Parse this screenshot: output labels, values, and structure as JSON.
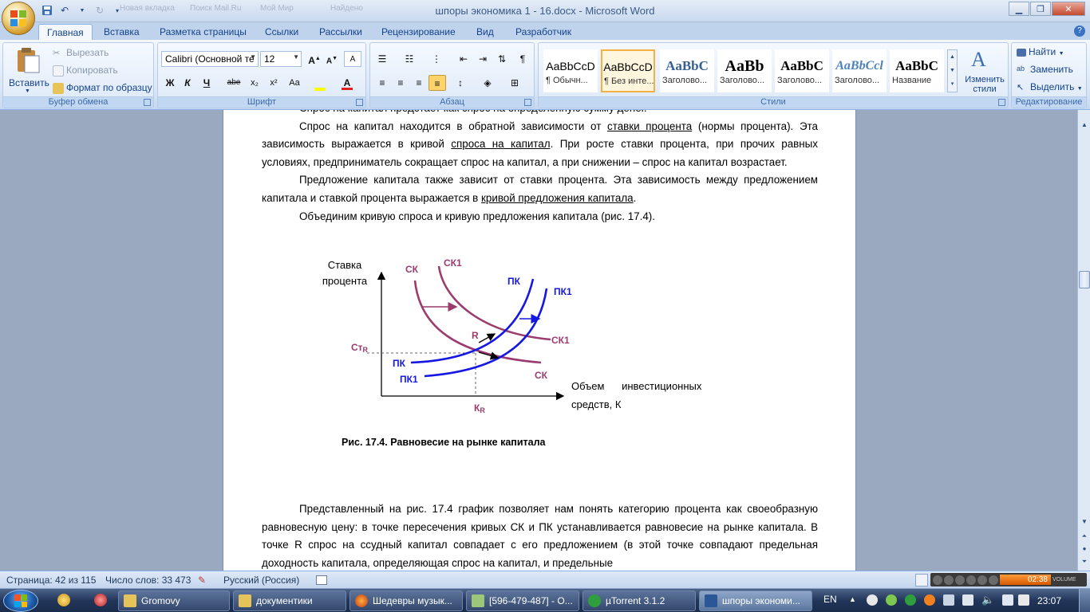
{
  "window": {
    "title": "шпоры экономика 1 - 16.docx - Microsoft Word",
    "background_tabs": [
      "Новая вкладка",
      "Поиск Mail.Ru",
      "Мой Мир",
      "Найдено",
      "Главная"
    ]
  },
  "colors": {
    "demand_curve": "#9b3b6e",
    "supply_curve": "#1418e0",
    "accent": "#f3b044",
    "ribbon_bg": "#dbe7f6"
  },
  "ribbon_tabs": [
    {
      "label": "Главная",
      "active": true
    },
    {
      "label": "Вставка"
    },
    {
      "label": "Разметка страницы"
    },
    {
      "label": "Ссылки"
    },
    {
      "label": "Рассылки"
    },
    {
      "label": "Рецензирование"
    },
    {
      "label": "Вид"
    },
    {
      "label": "Разработчик"
    }
  ],
  "clipboard": {
    "paste": "Вставить",
    "cut": "Вырезать",
    "copy": "Копировать",
    "format_painter": "Формат по образцу",
    "label": "Буфер обмена"
  },
  "font": {
    "family": "Calibri (Основной те",
    "size": "12",
    "label": "Шрифт",
    "buttons": [
      "Ж",
      "К",
      "Ч",
      "abe",
      "x₂",
      "x²",
      "Aa"
    ]
  },
  "paragraph": {
    "label": "Абзац"
  },
  "styles": {
    "label": "Стили",
    "items": [
      {
        "sample": "AaBbCcD",
        "name": "¶ Обычн..."
      },
      {
        "sample": "AaBbCcD",
        "name": "¶ Без инте...",
        "selected": true
      },
      {
        "sample": "AaBbC",
        "name": "Заголово..."
      },
      {
        "sample": "AaBb",
        "name": "Заголово..."
      },
      {
        "sample": "AaBbC",
        "name": "Заголово..."
      },
      {
        "sample": "AaBbCcl",
        "name": "Заголово..."
      },
      {
        "sample": "AaBbC",
        "name": "Название"
      }
    ],
    "change": "Изменить стили"
  },
  "editing": {
    "label": "Редактирование",
    "find": "Найти",
    "replace": "Заменить",
    "select": "Выделить"
  },
  "document": {
    "top_line": "Спрос на капитал предстает как спрос на определенную сумму денег.",
    "p1_a": "Спрос на капитал находится в обратной зависимости от ",
    "p1_link1": "ставки процента",
    "p1_b": " (нормы процента). Эта зависимость выражается в кривой ",
    "p1_link2": "спроса на капитал",
    "p1_c": ". При росте ставки процента, при прочих равных условиях, предприниматель сокращает спрос на капитал, а при снижении – спрос на капитал возрастает.",
    "p2_a": "Предложение капитала также зависит от ставки процента. Эта зависимость между предложением капитала и ставкой процента выражается в ",
    "p2_link": "кривой предложения капитала",
    "p2_b": ".",
    "p3": "Объединим кривую спроса и кривую предложения капитала (рис. 17.4).",
    "caption": "Рис. 17.4. Равновесие на рынке капитала",
    "p4": "Представленный на рис. 17.4 график позволяет нам понять категорию процента как своеобразную равновесную цену: в точке пересечения кривых СК и ПК устанавливается равновесие на рынке капитала. В точке R спрос на ссудный капитал совпадает с его предложением (в этой точке совпадают предельная доходность капитала, определяющая спрос на капитал,  и предельные"
  },
  "chart_data": {
    "type": "line",
    "title": "",
    "ylabel_line1": "Ставка",
    "ylabel_line2": "процента",
    "xlabel_line1": "Объем      инвестиционных",
    "xlabel_line2": "средств, К",
    "equilibrium_y_label": "Ст",
    "equilibrium_y_sub": "R",
    "equilibrium_x_label": "К",
    "equilibrium_x_sub": "R",
    "point_label": "R",
    "series": [
      {
        "name": "СК",
        "kind": "demand",
        "label_top": "СК",
        "label_bottom": "СК"
      },
      {
        "name": "СК1",
        "kind": "demand",
        "label_top": "СК1",
        "label_bottom": "СК1"
      },
      {
        "name": "ПК",
        "kind": "supply",
        "label_top": "ПК",
        "label_bottom": "ПК"
      },
      {
        "name": "ПК1",
        "kind": "supply",
        "label_top": "ПК1",
        "label_bottom": "ПК1"
      }
    ]
  },
  "statusbar": {
    "page": "Страница: 42 из 115",
    "words": "Число слов: 33 473",
    "language": "Русский (Россия)",
    "player_time": "02:38",
    "volume_label": "VOLUME"
  },
  "taskbar": {
    "items": [
      {
        "label": "Gromovy"
      },
      {
        "label": "документики"
      },
      {
        "label": "Шедевры музык..."
      },
      {
        "label": "[596-479-487] - О..."
      },
      {
        "label": "µTorrent 3.1.2"
      },
      {
        "label": "шпоры экономи...",
        "active": true
      }
    ],
    "lang": "EN",
    "time": "23:07"
  }
}
